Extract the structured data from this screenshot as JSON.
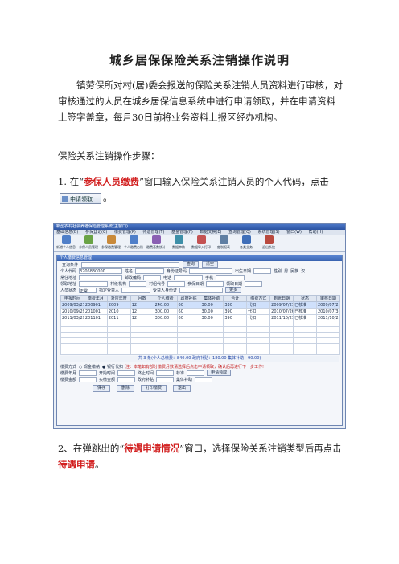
{
  "doc": {
    "title": "城乡居保保险关系注销操作说明",
    "para1": "镇劳保所对村(居)委会报送的保险关系注销人员资料进行审核，对审核通过的人员在城乡居保信息系统中进行申请领取，并在申请资料上签字盖章，每月30日前将业务资料上报区经办机构。",
    "steps_title": "保险关系注销操作步骤：",
    "step1_prefix": "1. 在“",
    "step1_red": "参保人员缴费",
    "step1_suffix": "”窗口输入保险关系注销人员的个人代码，点击",
    "step1_button": "申请领取",
    "step1_end": "。",
    "step2_prefix": "2、在弹跳出的“",
    "step2_red1": "待遇申请情况",
    "step2_mid": "”窗口，选择保险关系注销类型后再点击",
    "step2_red2": "待遇申请",
    "step2_end": "。"
  },
  "screenshot": {
    "app_title": "新型农村社会养老保险管理系统(主窗口)",
    "menu": [
      "基础信息(B)",
      "参保登记(C)",
      "缴费管理(P)",
      "待遇管理(T)",
      "基金管理(F)",
      "数据交换(E)",
      "查询管理(Q)",
      "系统管理(S)",
      "窗口(W)",
      "帮助(H)"
    ],
    "toolbar": [
      {
        "label": "新增个人信息",
        "color": "#4f7fc9"
      },
      {
        "label": "参保人员管理",
        "color": "#6aa346"
      },
      {
        "label": "参保缴费管理",
        "color": "#c98a3a"
      },
      {
        "label": "个人缴费台账",
        "color": "#4f7fc9"
      },
      {
        "label": "缴费基数统计",
        "color": "#8a5fb3"
      },
      {
        "label": "数据审核",
        "color": "#3d8fa8"
      },
      {
        "label": "数据导入打印",
        "color": "#c45252"
      },
      {
        "label": "定制报表",
        "color": "#5f7fa3"
      },
      {
        "label": "各类业务",
        "color": "#3f6fb9"
      },
      {
        "label": "退出系统",
        "color": "#b94a3f"
      }
    ],
    "inner_title": "个人缴费信息管理",
    "query_label": "查询条件",
    "query_btn": "查询",
    "reset_btn": "清空",
    "fields_row1": [
      "个人代码",
      "姓名",
      "身份证号码",
      "出生日期",
      "性别",
      "民族"
    ],
    "values_row1": [
      "3206830000",
      "",
      "",
      "",
      "男",
      "汉"
    ],
    "fields_row2": [
      "常住地址",
      "邮政编码",
      "电话",
      "手机"
    ],
    "fields_row3": [
      "领取地址",
      "村级机构",
      "村组代号",
      "参保日期",
      "领取日期"
    ],
    "fields_row4": [
      "人员状态",
      "指定受益人",
      "受益人身份证",
      "更多"
    ],
    "status_value": "正常",
    "grid_headers": [
      "申报时间",
      "缴费年月",
      "对应年度",
      "月数",
      "个人缴费",
      "政府补贴",
      "集体补助",
      "合计",
      "缴费方式",
      "到账日期",
      "状态",
      "审核日期"
    ],
    "grid_rows": [
      [
        "2009/03/27",
        "200901",
        "2009",
        "12",
        "240.00",
        "60",
        "30.00",
        "330",
        "代扣",
        "2009/07/21",
        "已核准",
        "2009/07/21"
      ],
      [
        "2010/09/29",
        "201001",
        "2010",
        "12",
        "300.00",
        "60",
        "30.00",
        "390",
        "代扣",
        "2010/07/26",
        "已核准",
        "2010/07/30"
      ],
      [
        "2011/03/29",
        "201101",
        "2011",
        "12",
        "300.00",
        "60",
        "30.00",
        "390",
        "代扣",
        "2011/10/21",
        "已核准",
        "2011/10/21"
      ]
    ],
    "sum_text": "共  3  条(个人总缴费：840.00   政府补贴：180.00   集体补助：90.00)",
    "pay_label": "缴费方式",
    "pay_opts": [
      "现金缴纳",
      "银行代扣"
    ],
    "tip": "注：本笔如有部分缴费月数请选择后点击申请领取，确认后再进行下一步工作!",
    "apply_btn": "申请领取",
    "row_b2": [
      "缴费年月",
      "开始时间",
      "终止时间",
      "标准"
    ],
    "row_b3": [
      "缴费金额",
      "实缴金额",
      "政府补贴",
      "集体补助"
    ],
    "bottom_btns": [
      "保存",
      "删除",
      "打印缴费",
      "退出"
    ]
  }
}
